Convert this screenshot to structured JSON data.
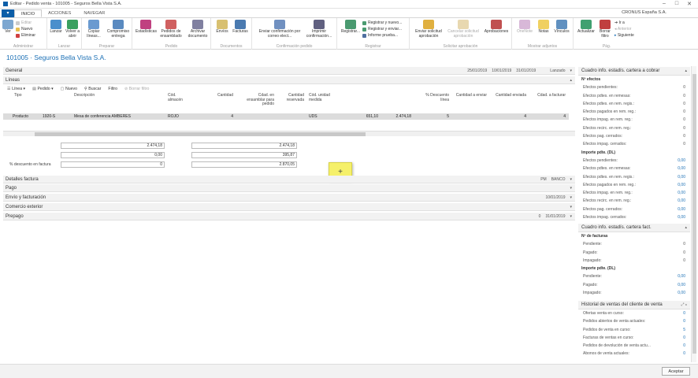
{
  "window": {
    "title": "Editar - Pedido venta - 101005 - Seguros Bella Vista S.A.",
    "minimize": "–",
    "maximize": "□",
    "close": "✕"
  },
  "tabs": {
    "file": "▾",
    "items": [
      "INICIO",
      "ACCIONES",
      "NAVEGAR"
    ]
  },
  "company": "CRONUS España S.A.",
  "ribbon": {
    "groups": [
      "Administrar",
      "Lanzar",
      "Preparar",
      "Pedido",
      "Documentos",
      "Confirmación pedido",
      "Registrar",
      "Solicitar aprobación",
      "Mostrar adjuntos",
      "Pág."
    ],
    "ver": "Ver",
    "editar": "Editar",
    "nuevo": "Nuevo",
    "eliminar": "Eliminar",
    "lanzar": "Lanzar",
    "volver_abrir": "Volver a abrir",
    "copiar_lineas": "Copiar líneas...",
    "compromiso_entrega": "Compromiso entrega",
    "estadisticas": "Estadísticas",
    "pedidos_ensamblado": "Pedidos de ensamblado",
    "archivar_documento": "Archivar documento",
    "envios": "Envíos",
    "facturas": "Facturas",
    "enviar_confirmacion": "Enviar confirmación por correo elect...",
    "imprimir_confirmacion": "Imprimir confirmación...",
    "registrar": "Registrar...",
    "registrar_nuevo": "Registrar y nuevo...",
    "registrar_enviar": "Registrar y enviar...",
    "informe_prueba": "Informe prueba...",
    "enviar_solicitud": "Enviar solicitud aprobación",
    "cancelar_solicitud": "Cancelar solicitud aprobación",
    "aprobaciones": "Aprobaciones",
    "onenote": "OneNote",
    "notas": "Notas",
    "vinculos": "Vínculos",
    "actualizar": "Actualizar",
    "borrar_filtro": "Borrar filtro",
    "ir_a": "Ir a",
    "anterior": "Anterior",
    "siguiente": "Siguiente"
  },
  "page_title": "101005 · Seguros Bella Vista S.A.",
  "general": {
    "label": "General",
    "dates": [
      "25/01/2019",
      "10/01/2019",
      "31/01/2019"
    ],
    "status": "Lanzado"
  },
  "lineas": {
    "label": "Líneas",
    "toolbar": [
      "Línea ▾",
      "Pedido ▾",
      "Nuevo",
      "Buscar",
      "Filtro",
      "Borrar filtro"
    ],
    "headers": [
      "Tipo",
      "Descripción",
      "Cód. almacén",
      "Cantidad",
      "Cdad. en ensamblar para pedido",
      "Cantidad reservada",
      "Cód. unidad medida",
      "% Descuento línea",
      "Cantidad a enviar",
      "Cantidad enviada",
      "Cdad. a facturar"
    ],
    "row": {
      "tipo": "Producto",
      "nro": "1920-S",
      "descripcion": "Mesa de conferencia AMBERES",
      "almacen": "ROJO",
      "cantidad": "4",
      "unidad": "UDS",
      "precio": "651,10",
      "importe": "2.474,18",
      "descuento": "5",
      "enviar": "4",
      "facturar": "4"
    }
  },
  "totals": {
    "left": [
      "2.474,18",
      "0,00",
      "0"
    ],
    "right": [
      "2.474,18",
      "395,87",
      "2.870,05"
    ],
    "discount_label": "% descuento en factura"
  },
  "yellow_button": "+",
  "sections": [
    {
      "label": "Detalles factura",
      "vals": [
        "PM",
        "BANCO"
      ]
    },
    {
      "label": "Pago",
      "vals": []
    },
    {
      "label": "Envío y facturación",
      "vals": [
        "10/01/2019"
      ]
    },
    {
      "label": "Comercio exterior",
      "vals": []
    },
    {
      "label": "Prepago",
      "vals": [
        "0",
        "31/01/2019"
      ]
    }
  ],
  "factbox1": {
    "title": "Cuadro info. estadís. cartera a cobrar",
    "sec1": "Nº efectos",
    "rows1": [
      "Efectos pendientes:",
      "Efectos pdtes. en remesas:",
      "Efectos pdtes. en rem. regis.:",
      "Efectos pagados en rem. reg.:",
      "Efectos impag. en rem. reg.:",
      "Efectos recirc. en rem. reg.:",
      "Efectos pag. cerrados:",
      "Efectos impag. cerrados:"
    ],
    "vals1": [
      "0",
      "0",
      "0",
      "0",
      "0",
      "0",
      "0",
      "0"
    ],
    "sec2": "Importe pdte. (DL)",
    "rows2": [
      "Efectos pendientes:",
      "Efectos pdtes. en remesas:",
      "Efectos pdtes. en rem. regis.:",
      "Efectos pagados en rem. reg.:",
      "Efectos impag. en rem. reg.:",
      "Efectos recirc. en rem. reg.:",
      "Efectos pag. cerrados:",
      "Efectos impag. cerrados:"
    ],
    "vals2": [
      "0,00",
      "0,00",
      "0,00",
      "0,00",
      "0,00",
      "0,00",
      "0,00",
      "0,00"
    ]
  },
  "factbox2": {
    "title": "Cuadro info. estadís. cartera fact.",
    "sec1": "Nº de facturas",
    "rows1": [
      "Pendiente:",
      "Pagado:",
      "Impagado:"
    ],
    "vals1": [
      "0",
      "0",
      "0"
    ],
    "sec2": "Importe pdte. (DL)",
    "rows2": [
      "Pendiente:",
      "Pagado:",
      "Impagado:"
    ],
    "vals2": [
      "0,00",
      "0,00",
      "0,00"
    ]
  },
  "factbox3": {
    "title": "Historial de ventas del cliente de venta",
    "rows": [
      "Ofertas venta en curso:",
      "Pedidos abiertos de venta actuales:",
      "Pedidos de venta en curso:",
      "Facturas de ventas en curso:",
      "Pedidos de devolución de venta actu...",
      "Abonos de venta actuales:"
    ],
    "vals": [
      "0",
      "0",
      "5",
      "0",
      "0",
      "0"
    ]
  },
  "ok_button": "Aceptar"
}
